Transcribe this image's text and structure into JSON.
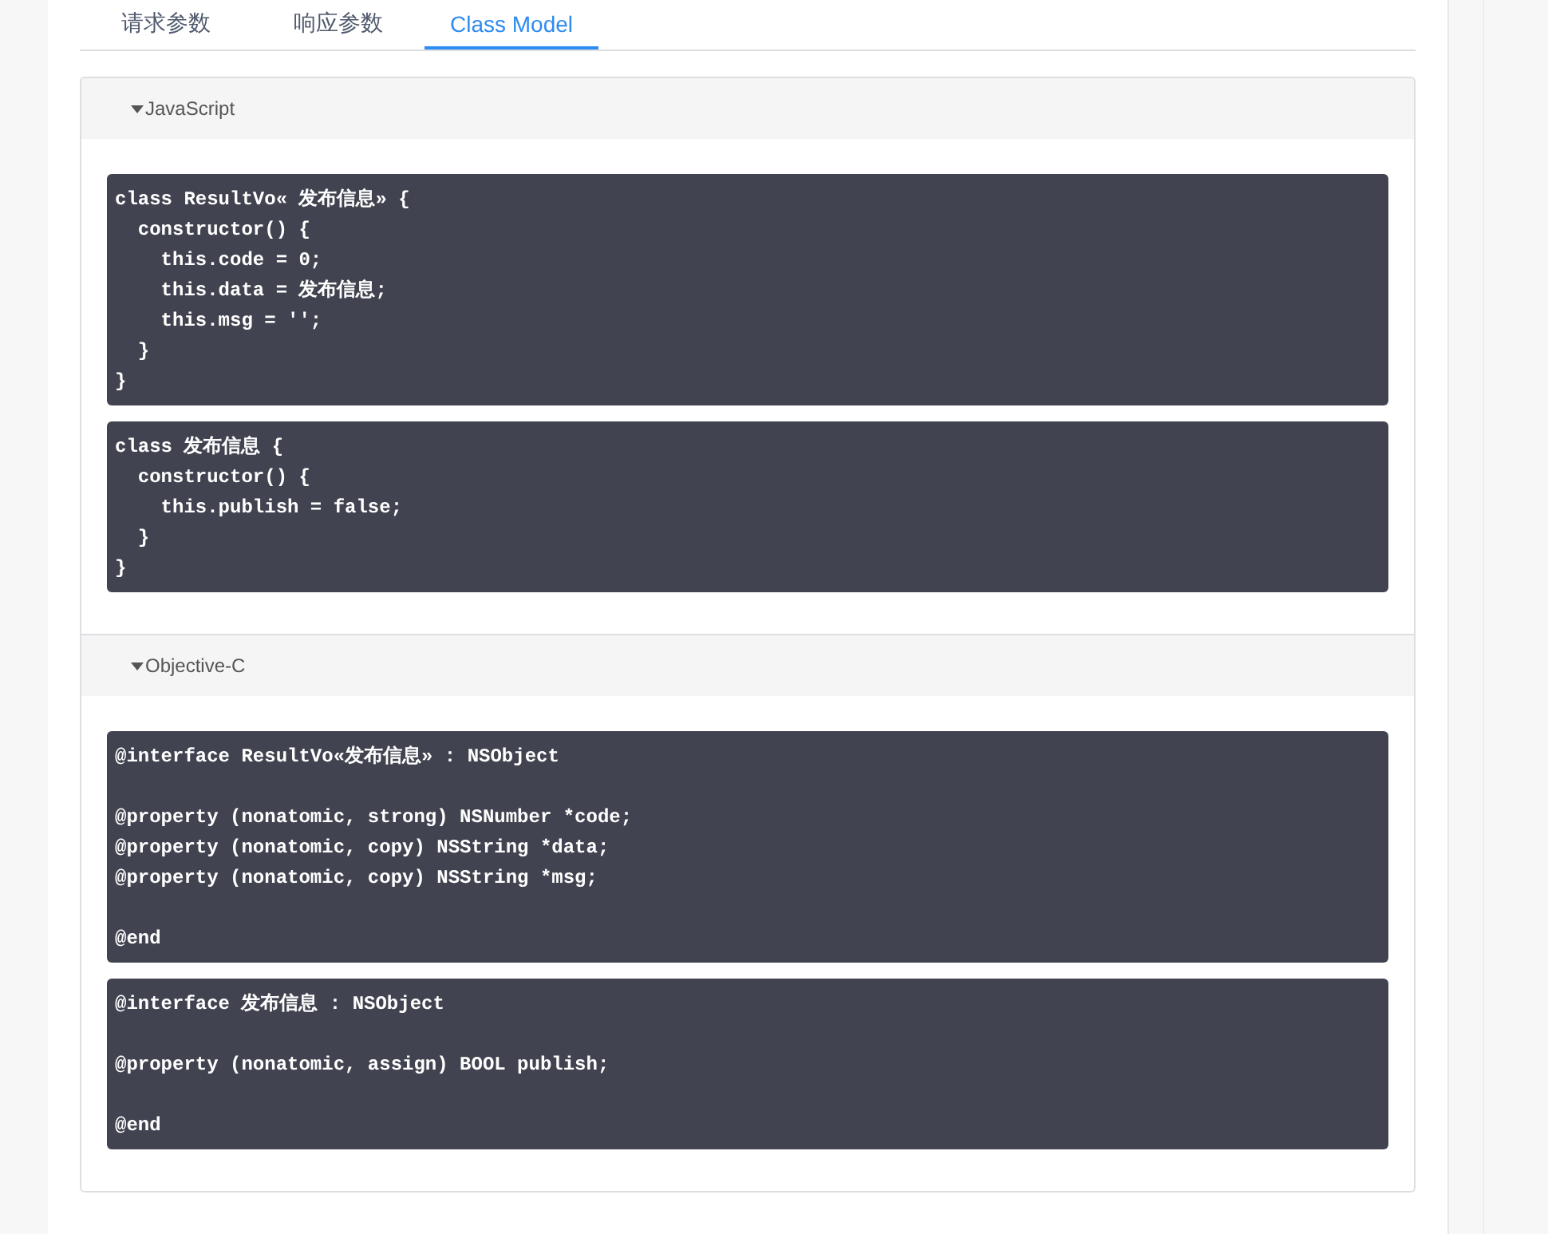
{
  "tabs": [
    {
      "label": "请求参数",
      "selected": false
    },
    {
      "label": "响应参数",
      "selected": false
    },
    {
      "label": "Class Model",
      "selected": true
    }
  ],
  "sections": [
    {
      "title": "JavaScript",
      "expanded": true,
      "code_blocks": [
        "class ResultVo« 发布信息» {\n  constructor() {\n    this.code = 0;\n    this.data = 发布信息;\n    this.msg = '';\n  }\n}",
        "class 发布信息 {\n  constructor() {\n    this.publish = false;\n  }\n}"
      ]
    },
    {
      "title": "Objective-C",
      "expanded": true,
      "code_blocks": [
        "@interface ResultVo«发布信息» : NSObject\n\n@property (nonatomic, strong) NSNumber *code;\n@property (nonatomic, copy) NSString *data;\n@property (nonatomic, copy) NSString *msg;\n\n@end",
        "@interface 发布信息 : NSObject\n\n@property (nonatomic, assign) BOOL publish;\n\n@end"
      ]
    }
  ]
}
